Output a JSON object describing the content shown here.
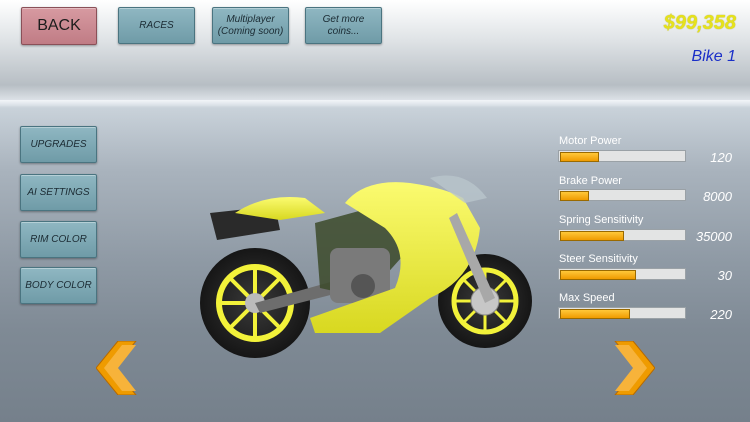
{
  "header": {
    "back_label": "BACK",
    "races_label": "RACES",
    "multiplayer_label": "Multiplayer\n(Coming soon)",
    "coins_label": "Get more\ncoins...",
    "money": "$99,358",
    "bike_name": "Bike 1"
  },
  "sidebar": {
    "items": [
      {
        "label": "UPGRADES"
      },
      {
        "label": "AI SETTINGS"
      },
      {
        "label": "RIM COLOR"
      },
      {
        "label": "BODY COLOR"
      }
    ]
  },
  "stats": [
    {
      "label": "Motor Power",
      "value": "120",
      "fill": 0.3
    },
    {
      "label": "Brake Power",
      "value": "8000",
      "fill": 0.22
    },
    {
      "label": "Spring Sensitivity",
      "value": "35000",
      "fill": 0.5
    },
    {
      "label": "Steer Sensitivity",
      "value": "30",
      "fill": 0.6
    },
    {
      "label": "Max Speed",
      "value": "220",
      "fill": 0.55
    }
  ],
  "colors": {
    "accent_orange": "#ef9b00",
    "bike_body": "#f2f23a",
    "money": "#e6e21c",
    "bike_name": "#1a2fc8"
  },
  "icons": {
    "prev": "chevron-left-icon",
    "next": "chevron-right-icon"
  }
}
